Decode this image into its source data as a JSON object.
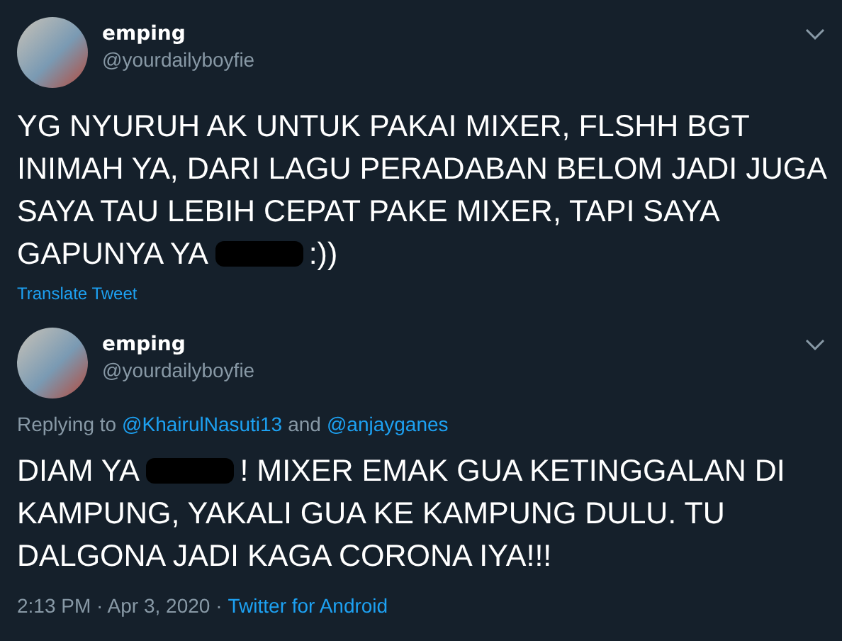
{
  "tweets": [
    {
      "name": "emping",
      "handle": "@yourdailyboyfie",
      "body": {
        "before": "YG NYURUH AK UNTUK PAKAI MIXER, FLSHH BGT INIMAH YA, DARI LAGU PERADABAN BELOM JADI JUGA SAYA TAU LEBIH CEPAT PAKE MIXER, TAPI SAYA GAPUNYA YA",
        "redacted": true,
        "after": ":))"
      },
      "translate": "Translate Tweet"
    },
    {
      "name": "emping",
      "handle": "@yourdailyboyfie",
      "replying_to": {
        "label": "Replying to",
        "users": [
          "@KhairulNasuti13",
          "@anjayganes"
        ],
        "joiner": "and"
      },
      "body": {
        "before": "DIAM YA",
        "redacted": true,
        "after": "! MIXER EMAK GUA KETINGGALAN DI KAMPUNG, YAKALI GUA KE KAMPUNG DULU. TU DALGONA JADI KAGA CORONA IYA!!!"
      },
      "meta": {
        "time": "2:13 PM · Apr 3, 2020 ·",
        "source": "Twitter for Android"
      }
    }
  ]
}
